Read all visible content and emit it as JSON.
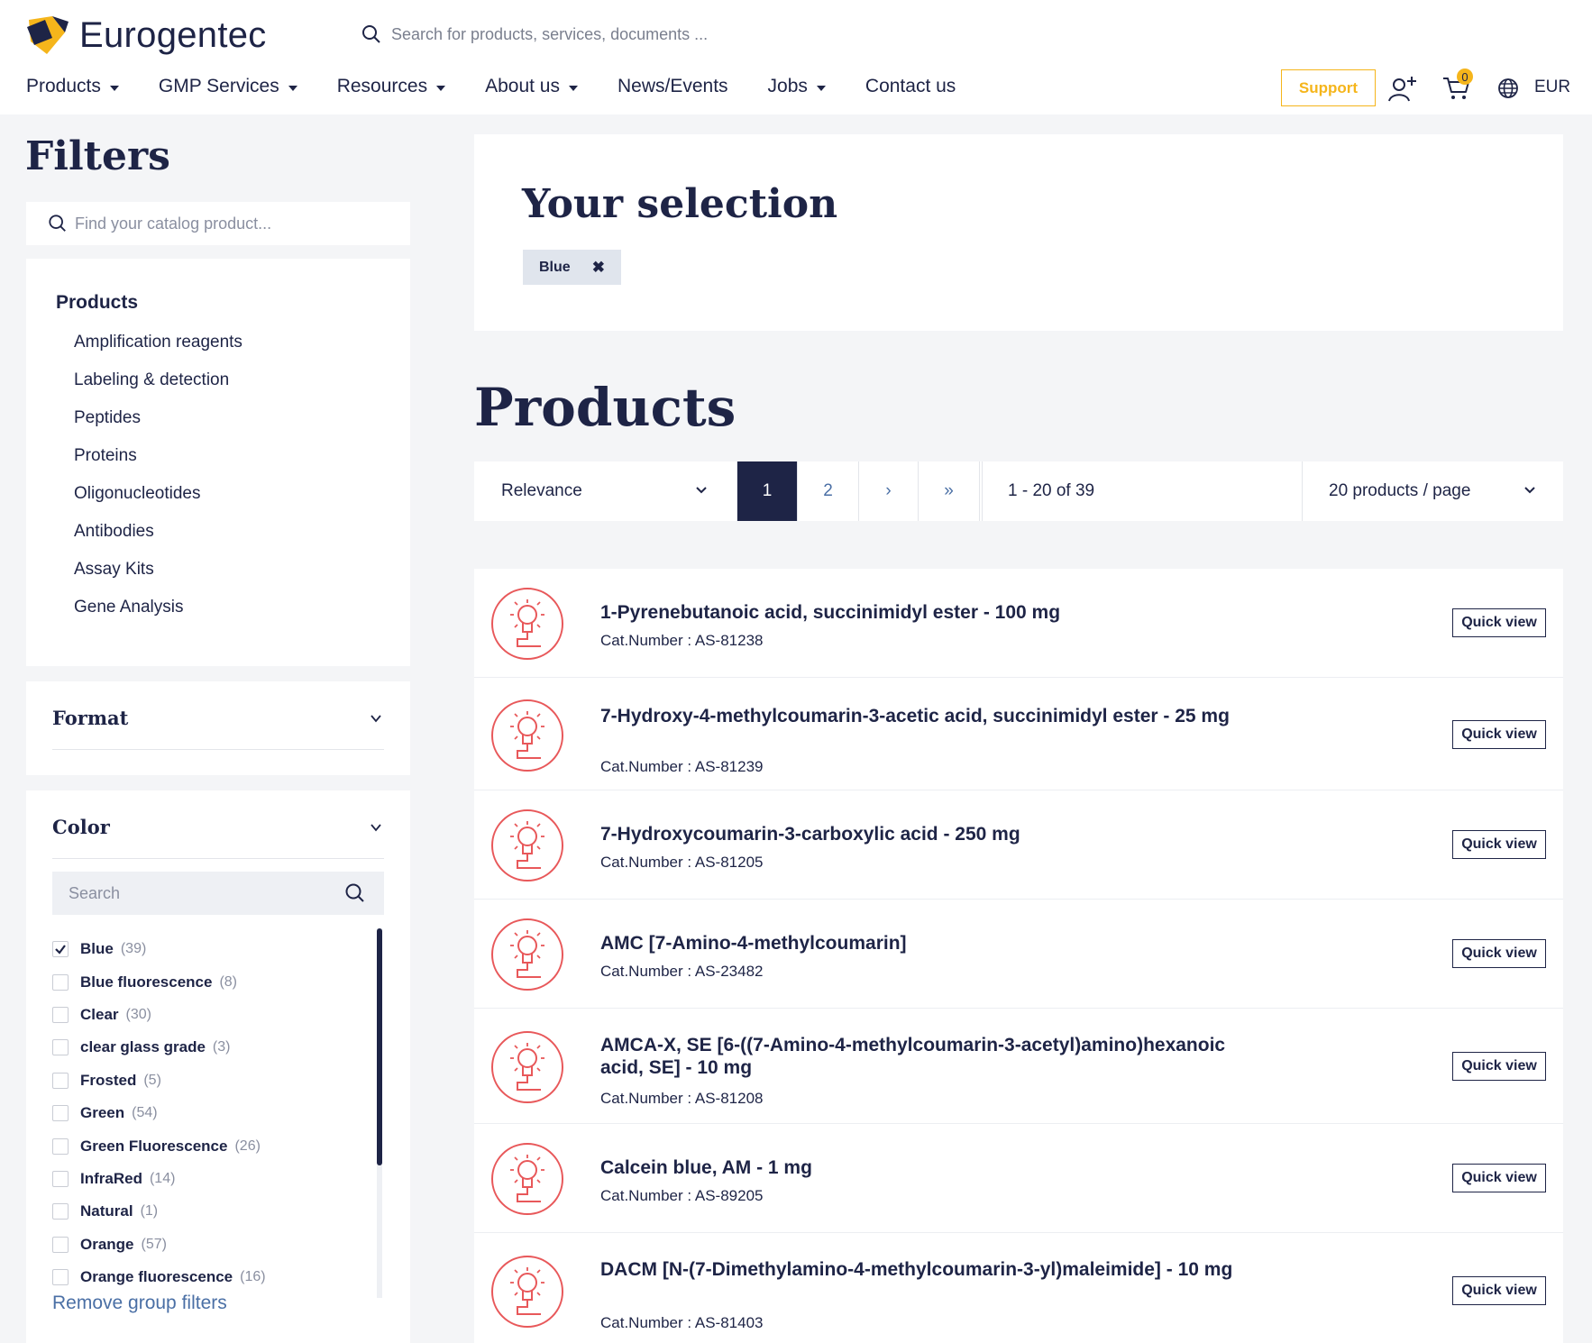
{
  "header": {
    "logo_text": "Eurogentec",
    "search_placeholder": "Search for products, services, documents ...",
    "nav": [
      {
        "label": "Products"
      },
      {
        "label": "GMP Services"
      },
      {
        "label": "Resources"
      },
      {
        "label": "About us"
      },
      {
        "label": "News/Events"
      },
      {
        "label": "Jobs"
      },
      {
        "label": "Contact us"
      }
    ],
    "support_label": "Support",
    "cart_count": "0",
    "currency": "EUR",
    "brand_accent": "#f5b51b",
    "brand_navy": "#1e2446"
  },
  "sidebar": {
    "title": "Filters",
    "catalog_search_placeholder": "Find your catalog product...",
    "products_heading": "Products",
    "categories": [
      "Amplification reagents",
      "Labeling & detection",
      "Peptides",
      "Proteins",
      "Oligonucleotides",
      "Antibodies",
      "Assay Kits",
      "Gene Analysis"
    ],
    "format_heading": "Format",
    "color_heading": "Color",
    "color_search_placeholder": "Search",
    "colors": [
      {
        "label": "Blue",
        "count": "(39)",
        "checked": true
      },
      {
        "label": "Blue fluorescence",
        "count": "(8)",
        "checked": false
      },
      {
        "label": "Clear",
        "count": "(30)",
        "checked": false
      },
      {
        "label": "clear glass grade",
        "count": "(3)",
        "checked": false
      },
      {
        "label": "Frosted",
        "count": "(5)",
        "checked": false
      },
      {
        "label": "Green",
        "count": "(54)",
        "checked": false
      },
      {
        "label": "Green Fluorescence",
        "count": "(26)",
        "checked": false
      },
      {
        "label": "InfraRed",
        "count": "(14)",
        "checked": false
      },
      {
        "label": "Natural",
        "count": "(1)",
        "checked": false
      },
      {
        "label": "Orange",
        "count": "(57)",
        "checked": false
      },
      {
        "label": "Orange fluorescence",
        "count": "(16)",
        "checked": false
      }
    ],
    "remove_filters": "Remove group filters"
  },
  "selection": {
    "title": "Your selection",
    "chips": [
      {
        "label": "Blue",
        "remove": "✖"
      }
    ]
  },
  "products": {
    "title": "Products",
    "sort_label": "Relevance",
    "pagination": {
      "pages": [
        "1",
        "2"
      ],
      "next": "›",
      "last": "»",
      "current": "1"
    },
    "range_text": "1 - 20 of 39",
    "per_page_label": "20 products / page",
    "quick_view_label": "Quick view",
    "icon_color": "#e8585a",
    "items": [
      {
        "title": "1-Pyrenebutanoic acid, succinimidyl ester - 100 mg",
        "cat": "Cat.Number : AS-81238"
      },
      {
        "title": "7-Hydroxy-4-methylcoumarin-3-acetic acid, succinimidyl ester - 25 mg",
        "cat": "Cat.Number : AS-81239"
      },
      {
        "title": "7-Hydroxycoumarin-3-carboxylic acid - 250 mg",
        "cat": "Cat.Number : AS-81205"
      },
      {
        "title": "AMC [7-Amino-4-methylcoumarin]",
        "cat": "Cat.Number : AS-23482"
      },
      {
        "title": "AMCA-X, SE [6-((7-Amino-4-methylcoumarin-3-acetyl)amino)hexanoic acid, SE] - 10 mg",
        "cat": "Cat.Number : AS-81208"
      },
      {
        "title": "Calcein blue, AM - 1 mg",
        "cat": "Cat.Number : AS-89205"
      },
      {
        "title": "DACM [N-(7-Dimethylamino-4-methylcoumarin-3-yl)maleimide] - 10 mg",
        "cat": "Cat.Number : AS-81403"
      }
    ]
  }
}
